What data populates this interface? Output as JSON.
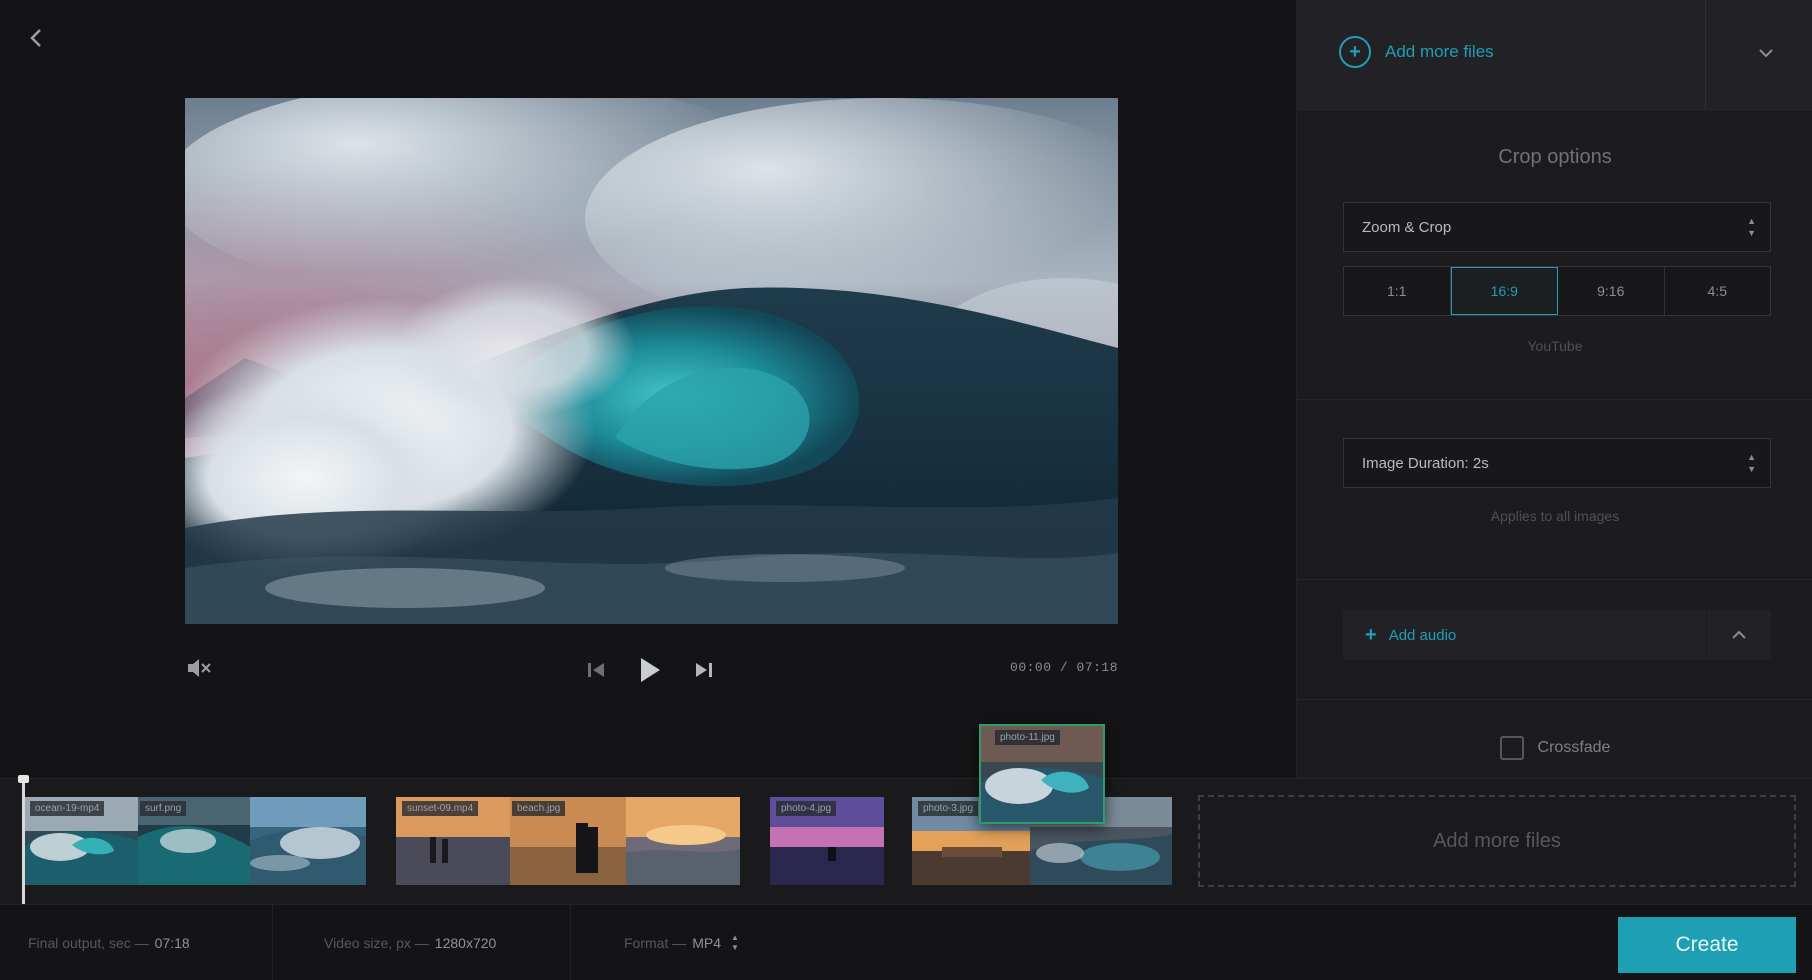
{
  "colors": {
    "accent": "#1e9fb4",
    "drag_border": "#2a9d6a",
    "background": "#121214",
    "panel": "#1c1c1f"
  },
  "header": {
    "back_icon": "chevron-left-icon"
  },
  "player": {
    "time_current": "00:00",
    "time_separator": "/",
    "time_total": "07:18",
    "mute_icon": "speaker-muted-icon",
    "prev_icon": "skip-previous-icon",
    "play_icon": "play-icon",
    "next_icon": "skip-next-icon"
  },
  "panel": {
    "add_more_files": "Add more files",
    "add_icon": "plus-circle-icon",
    "collapse_icon": "chevron-down-icon",
    "crop_section": {
      "title": "Crop options",
      "crop_mode": "Zoom & Crop",
      "ratios": [
        "1:1",
        "16:9",
        "9:16",
        "4:5"
      ],
      "active_ratio": "16:9",
      "ratio_hint": "YouTube"
    },
    "duration_section": {
      "image_duration": "Image Duration: 2s",
      "hint": "Applies to all images"
    },
    "audio_section": {
      "add_audio": "Add audio",
      "expand_icon": "chevron-up-icon"
    },
    "crossfade": {
      "label": "Crossfade",
      "checked": false
    }
  },
  "timeline": {
    "clips": [
      {
        "label": "ocean-19-mp4",
        "label2": "surf.png"
      },
      {
        "label": "sunset-09.mp4",
        "label2": "beach.jpg"
      },
      {
        "label": "photo-4.jpg"
      },
      {
        "label": "photo-3.jpg"
      }
    ],
    "dragging_label": "photo-11.jpg",
    "dropzone_label": "Add more files"
  },
  "footer": {
    "final_output_label": "Final output, sec —",
    "final_output_value": "07:18",
    "video_size_label": "Video size, px —",
    "video_size_value": "1280x720",
    "format_label": "Format —",
    "format_value": "MP4",
    "create_label": "Create"
  }
}
